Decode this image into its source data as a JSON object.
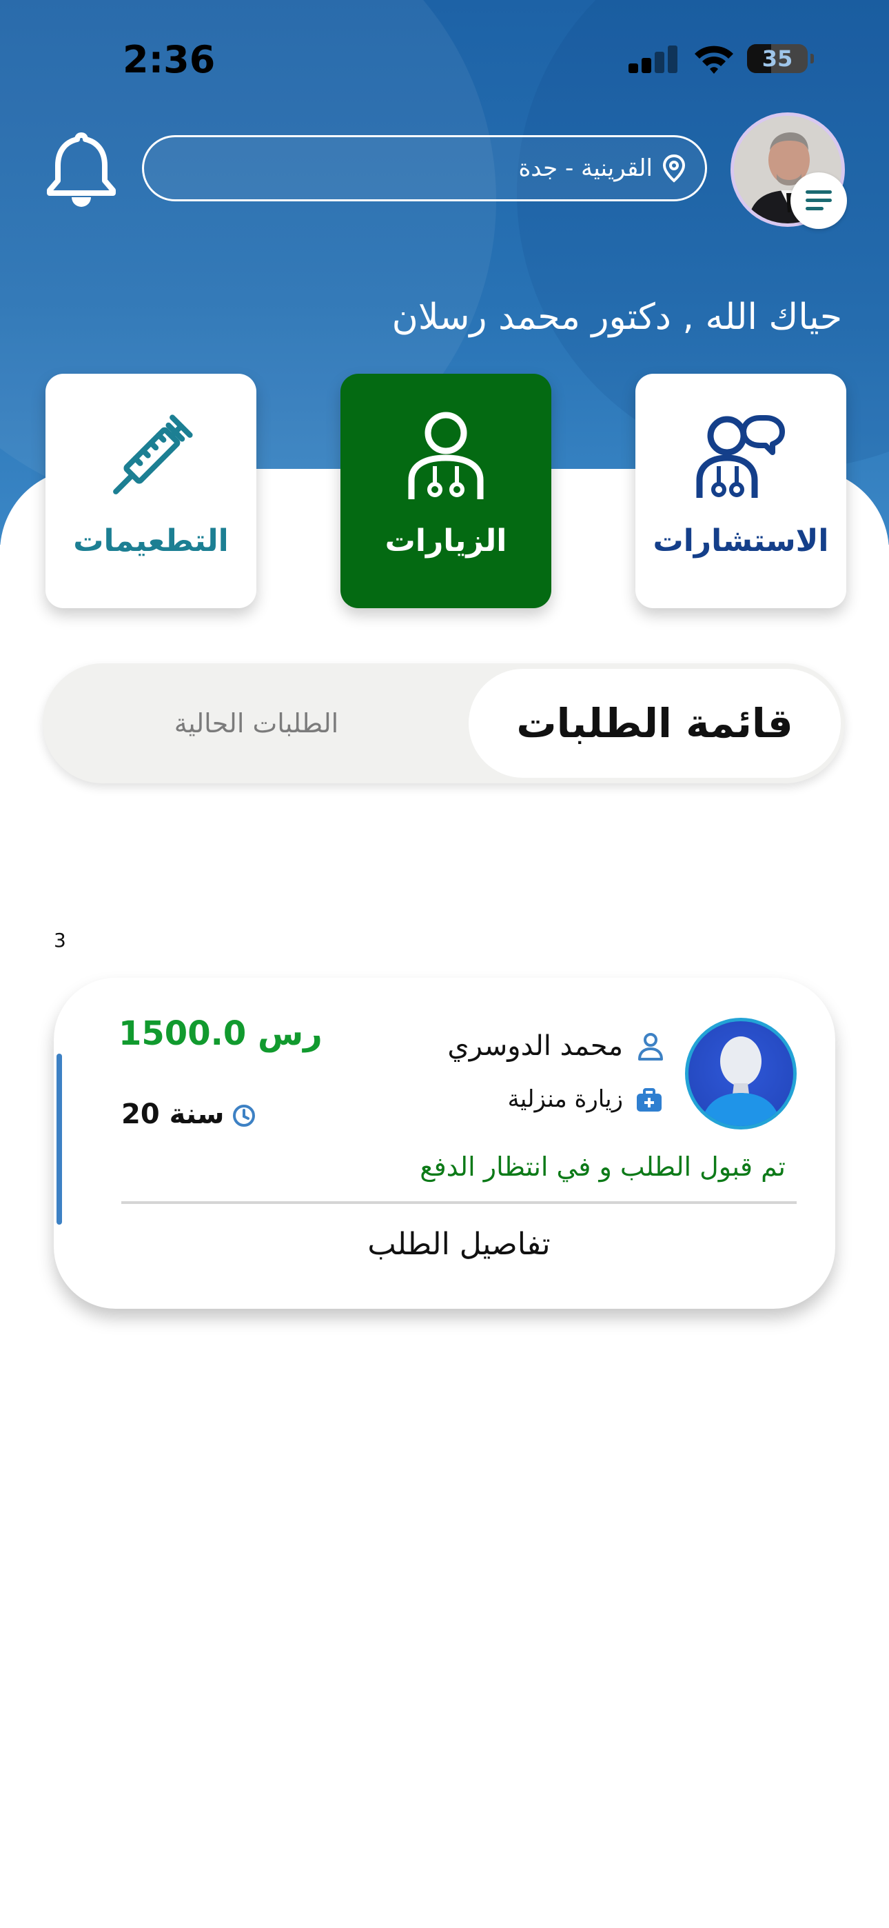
{
  "status_bar": {
    "time": "2:36",
    "battery": "35"
  },
  "header": {
    "location": "القرينية - جدة",
    "greeting": "حياك الله ,  دكتور محمد رسلان"
  },
  "services": [
    {
      "label": "الاستشارات",
      "icon": "consultation-icon",
      "color": "#143f8a",
      "active": false
    },
    {
      "label": "الزيارات",
      "icon": "doctor-icon",
      "color": "#ffffff",
      "active": true
    },
    {
      "label": "التطعيمات",
      "icon": "syringe-icon",
      "color": "#1c7f93",
      "active": false
    }
  ],
  "tabs": {
    "active": "قائمة الطلبات",
    "inactive": "الطلبات الحالية"
  },
  "requests": {
    "count": "3",
    "items": [
      {
        "patient_name": "محمد الدوسري",
        "visit_type": "زيارة منزلية",
        "price": "1500.0 رس",
        "age": "20 سنة",
        "status": "تم قبول الطلب و في انتظار الدفع",
        "details_label": "تفاصيل الطلب"
      }
    ]
  },
  "colors": {
    "header_blue": "#1d62a6",
    "active_green": "#046a12",
    "price_green": "#119a2e",
    "accent_blue": "#3d81c4"
  }
}
